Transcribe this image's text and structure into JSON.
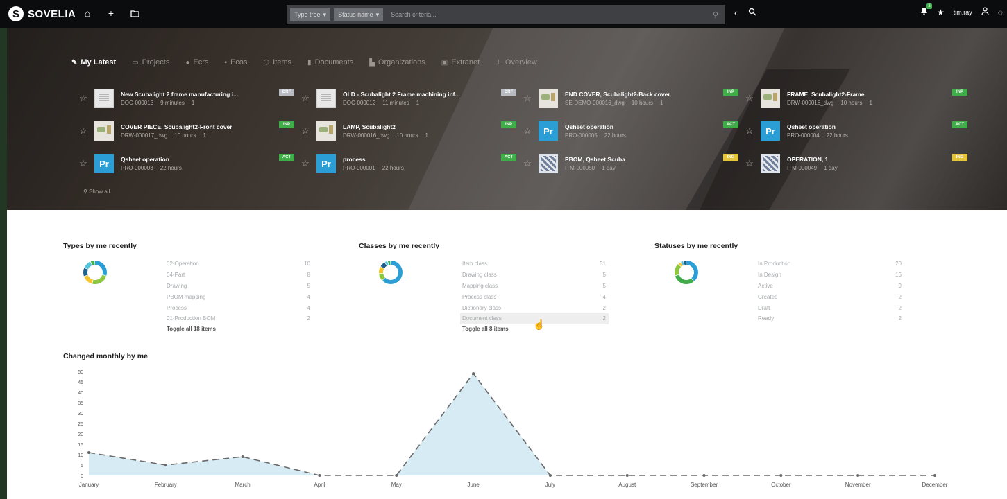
{
  "app": {
    "brand_letter": "S",
    "brand_name": "SOVELIA"
  },
  "topbar": {
    "icons": [
      "home-icon",
      "plus-icon",
      "folder-icon"
    ],
    "filters": [
      {
        "label": "Type tree"
      },
      {
        "label": "Status name"
      }
    ],
    "search_placeholder": "Search criteria...",
    "nav": [
      "back-icon",
      "search-zoom-icon"
    ],
    "notifications_count": "3",
    "username": "tim.ray"
  },
  "tabs": [
    {
      "label": "My Latest",
      "icon": "pencil-icon",
      "active": true
    },
    {
      "label": "Projects",
      "icon": "projects-icon"
    },
    {
      "label": "Ecrs",
      "icon": "ecrs-icon"
    },
    {
      "label": "Ecos",
      "icon": "ecos-icon"
    },
    {
      "label": "Items",
      "icon": "items-icon"
    },
    {
      "label": "Documents",
      "icon": "documents-icon"
    },
    {
      "label": "Organizations",
      "icon": "organizations-icon"
    },
    {
      "label": "Extranet",
      "icon": "extranet-icon"
    },
    {
      "label": "Overview",
      "icon": "overview-icon"
    }
  ],
  "latest_items": [
    {
      "title": "New Scubalight 2 frame manufacturing i...",
      "code": "DOC-000013",
      "age": "9 minutes",
      "count": "1",
      "badge": "DRF",
      "badge_color": "#b8bcc2",
      "thumb": "doc"
    },
    {
      "title": "OLD - Scubalight 2 Frame machining inf...",
      "code": "DOC-000012",
      "age": "11 minutes",
      "count": "1",
      "badge": "DRF",
      "badge_color": "#b8bcc2",
      "thumb": "doc"
    },
    {
      "title": "END COVER, Scubalight2-Back cover",
      "code": "SE-DEMO-000016_dwg",
      "age": "10 hours",
      "count": "1",
      "badge": "INP",
      "badge_color": "#3fae49",
      "thumb": "drw"
    },
    {
      "title": "FRAME, Scubalight2-Frame",
      "code": "DRW-000018_dwg",
      "age": "10 hours",
      "count": "1",
      "badge": "INP",
      "badge_color": "#3fae49",
      "thumb": "drw"
    },
    {
      "title": "COVER PIECE, Scubalight2-Front cover",
      "code": "DRW-000017_dwg",
      "age": "10 hours",
      "count": "1",
      "badge": "INP",
      "badge_color": "#3fae49",
      "thumb": "drw"
    },
    {
      "title": "LAMP, Scubalight2",
      "code": "DRW-000016_dwg",
      "age": "10 hours",
      "count": "1",
      "badge": "INP",
      "badge_color": "#3fae49",
      "thumb": "drw"
    },
    {
      "title": "Qsheet operation",
      "code": "PRO-000005",
      "age": "22 hours",
      "count": "",
      "badge": "ACT",
      "badge_color": "#3fae49",
      "thumb": "pr"
    },
    {
      "title": "Qsheet operation",
      "code": "PRO-000004",
      "age": "22 hours",
      "count": "",
      "badge": "ACT",
      "badge_color": "#3fae49",
      "thumb": "pr"
    },
    {
      "title": "Qsheet operation",
      "code": "PRO-000003",
      "age": "22 hours",
      "count": "",
      "badge": "ACT",
      "badge_color": "#3fae49",
      "thumb": "pr"
    },
    {
      "title": "process",
      "code": "PRO-000001",
      "age": "22 hours",
      "count": "",
      "badge": "ACT",
      "badge_color": "#3fae49",
      "thumb": "pr"
    },
    {
      "title": "PBOM, Qsheet Scuba",
      "code": "ITM-000050",
      "age": "1 day",
      "count": "",
      "badge": "ING",
      "badge_color": "#e3c43b",
      "thumb": "itm"
    },
    {
      "title": "OPERATION, 1",
      "code": "ITM-000049",
      "age": "1 day",
      "count": "",
      "badge": "ING",
      "badge_color": "#e3c43b",
      "thumb": "itm"
    }
  ],
  "pr_label": "Pr",
  "show_all": "Show all",
  "panels": [
    {
      "title": "Types by me recently",
      "toggle": "Toggle all 18 items",
      "rows": [
        {
          "label": "02-Operation",
          "value": 10
        },
        {
          "label": "04-Part",
          "value": 8
        },
        {
          "label": "Drawing",
          "value": 5
        },
        {
          "label": "PBOM mapping",
          "value": 4
        },
        {
          "label": "Process",
          "value": 4
        },
        {
          "label": "01-Production BOM",
          "value": 2
        }
      ],
      "donut_colors": [
        "#2b9ed6",
        "#8dc63f",
        "#f4c430",
        "#1f5f8b",
        "#58c4dc",
        "#3fae49",
        "#a6d7ee",
        "#777777",
        "#ffd966",
        "#4c9f70"
      ]
    },
    {
      "title": "Classes by me recently",
      "toggle": "Toggle all 8 items",
      "rows": [
        {
          "label": "Item class",
          "value": 31
        },
        {
          "label": "Drawing class",
          "value": 5
        },
        {
          "label": "Mapping class",
          "value": 5
        },
        {
          "label": "Process class",
          "value": 4
        },
        {
          "label": "Dictionary class",
          "value": 2
        },
        {
          "label": "Document class",
          "value": 2
        }
      ],
      "donut_colors": [
        "#2b9ed6",
        "#8dc63f",
        "#f4c430",
        "#1f5f8b",
        "#58c4dc",
        "#3fae49"
      ]
    },
    {
      "title": "Statuses by me recently",
      "toggle": "",
      "rows": [
        {
          "label": "In Production",
          "value": 20
        },
        {
          "label": "In Design",
          "value": 16
        },
        {
          "label": "Active",
          "value": 9
        },
        {
          "label": "Created",
          "value": 2
        },
        {
          "label": "Draft",
          "value": 2
        },
        {
          "label": "Ready",
          "value": 2
        }
      ],
      "donut_colors": [
        "#2b9ed6",
        "#3fae49",
        "#8dc63f",
        "#f4c430",
        "#58c4dc",
        "#1f5f8b"
      ]
    }
  ],
  "chart_title": "Changed monthly by me",
  "chart_data": {
    "type": "area",
    "title": "Changed monthly by me",
    "x": [
      "January",
      "February",
      "March",
      "April",
      "May",
      "June",
      "July",
      "August",
      "September",
      "October",
      "November",
      "December"
    ],
    "series": [
      {
        "values": [
          11,
          5,
          9,
          0,
          0,
          49,
          0,
          0,
          0,
          0,
          0,
          0
        ]
      }
    ],
    "ylim": [
      0,
      50
    ],
    "yticks": [
      0,
      5,
      10,
      15,
      20,
      25,
      30,
      35,
      40,
      45,
      50
    ],
    "fill_color": "#d7ebf4",
    "line_color": "#6a6a6a",
    "grid": false
  }
}
